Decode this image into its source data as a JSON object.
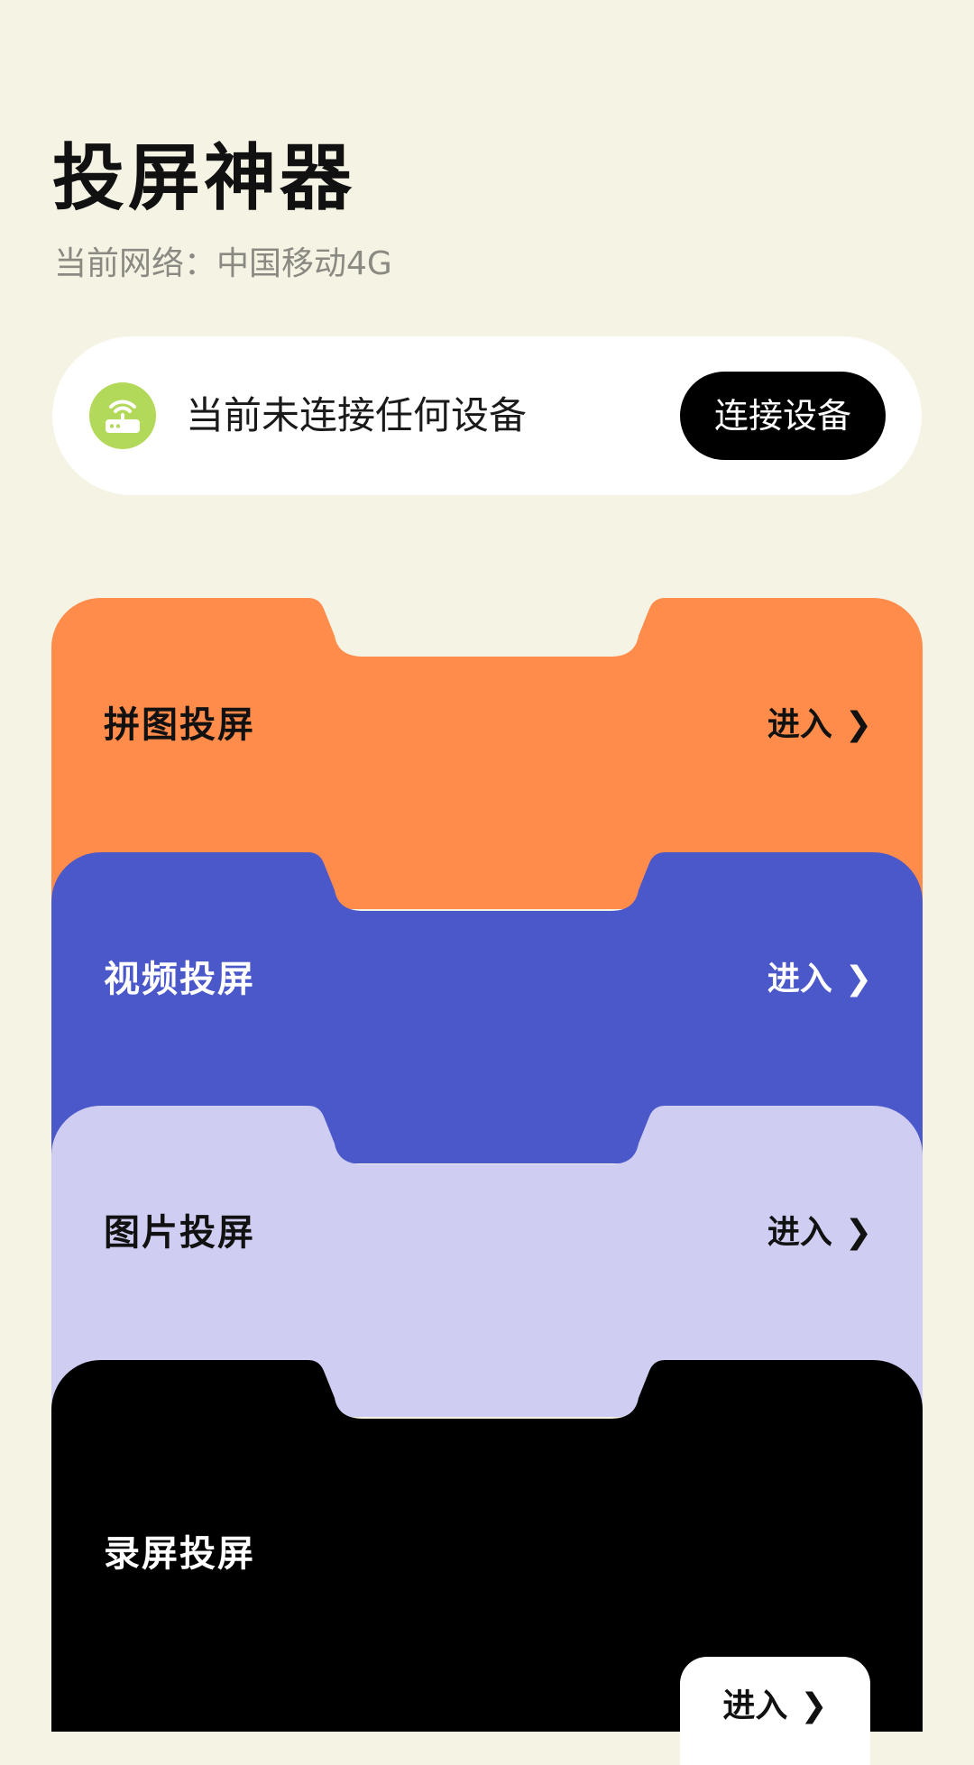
{
  "header": {
    "title": "投屏神器",
    "network_label": "当前网络：中国移动4G"
  },
  "status": {
    "icon": "router-icon",
    "text": "当前未连接任何设备",
    "connect_button": "连接设备",
    "icon_color": "#b3d95a"
  },
  "features": [
    {
      "title": "拼图投屏",
      "enter": "进入",
      "color": "#ff8c4a",
      "text_color": "#111111"
    },
    {
      "title": "视频投屏",
      "enter": "进入",
      "color": "#4b58ca",
      "text_color": "#ffffff"
    },
    {
      "title": "图片投屏",
      "enter": "进入",
      "color": "#cfcdf1",
      "text_color": "#111111"
    },
    {
      "title": "录屏投屏",
      "enter": "进入",
      "color": "#000000",
      "text_color": "#ffffff"
    }
  ],
  "icons": {
    "chevron": "chevron-right-icon"
  }
}
